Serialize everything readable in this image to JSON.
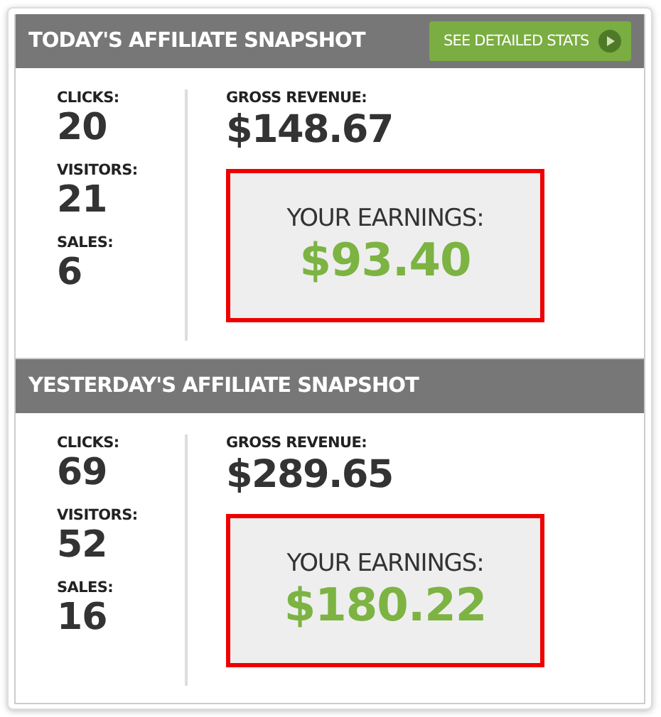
{
  "sections": [
    {
      "title": "TODAY'S AFFILIATE SNAPSHOT",
      "button": {
        "label": "SEE DETAILED STATS"
      },
      "stats": [
        {
          "label": "CLICKS:",
          "value": "20"
        },
        {
          "label": "VISITORS:",
          "value": "21"
        },
        {
          "label": "SALES:",
          "value": "6"
        }
      ],
      "gross": {
        "label": "GROSS REVENUE:",
        "value": "$148.67"
      },
      "earnings": {
        "label": "YOUR EARNINGS:",
        "value": "$93.40"
      }
    },
    {
      "title": "YESTERDAY'S AFFILIATE SNAPSHOT",
      "stats": [
        {
          "label": "CLICKS:",
          "value": "69"
        },
        {
          "label": "VISITORS:",
          "value": "52"
        },
        {
          "label": "SALES:",
          "value": "16"
        }
      ],
      "gross": {
        "label": "GROSS REVENUE:",
        "value": "$289.65"
      },
      "earnings": {
        "label": "YOUR EARNINGS:",
        "value": "$180.22"
      }
    }
  ]
}
